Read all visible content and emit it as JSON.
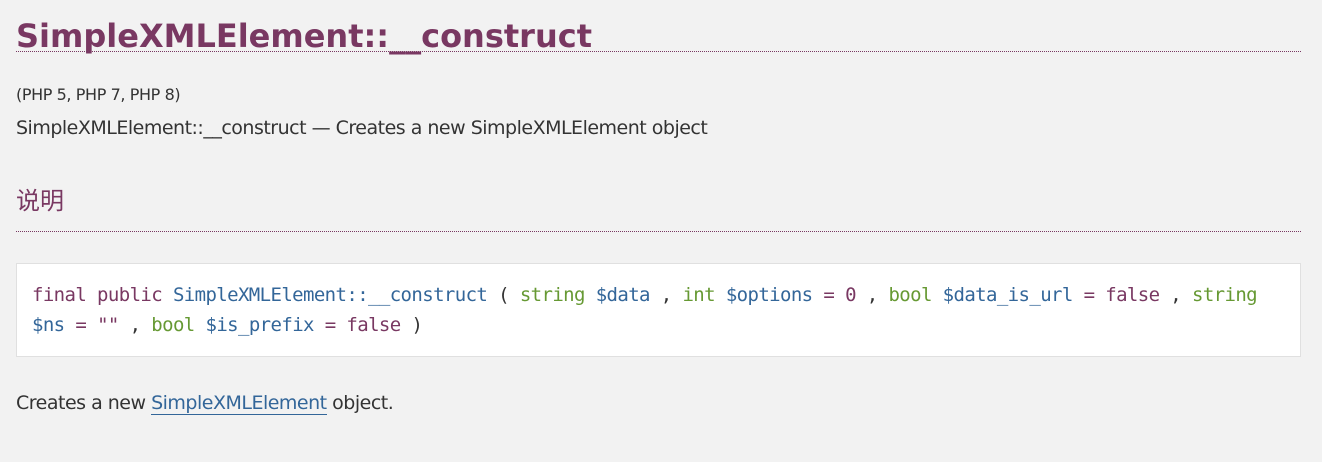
{
  "page": {
    "title": "SimpleXMLElement::__construct",
    "versions": "(PHP 5, PHP 7, PHP 8)",
    "purpose": "SimpleXMLElement::__construct — Creates a new SimpleXMLElement object"
  },
  "section": {
    "title": "说明"
  },
  "synopsis": {
    "modifier_final": "final",
    "modifier_public": "public",
    "method_name": "SimpleXMLElement::__construct",
    "open_paren": "(",
    "close_paren": ")",
    "params": [
      {
        "type": "string",
        "name": "$data",
        "default": ""
      },
      {
        "type": "int",
        "name": "$options",
        "default": "0"
      },
      {
        "type": "bool",
        "name": "$data_is_url",
        "default": "false"
      },
      {
        "type": "string",
        "name": "$ns",
        "default": "\"\""
      },
      {
        "type": "bool",
        "name": "$is_prefix",
        "default": "false"
      }
    ]
  },
  "description": {
    "prefix": "Creates a new",
    "link_text": "SimpleXMLElement",
    "suffix": "object."
  },
  "colors": {
    "accent": "#793862",
    "link": "#336699",
    "type": "#669933",
    "background": "#f2f2f2"
  }
}
